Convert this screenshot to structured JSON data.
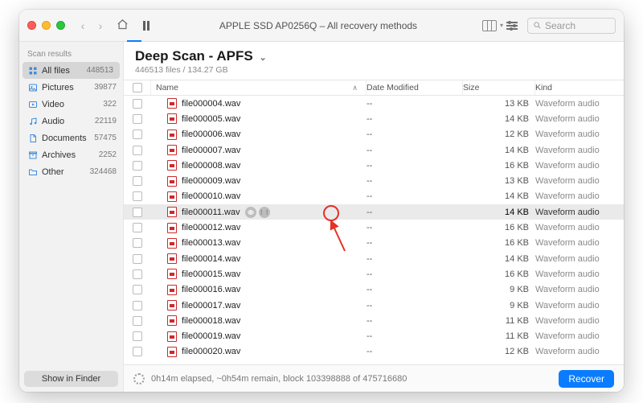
{
  "window": {
    "title": "APPLE SSD AP0256Q – All recovery methods",
    "search_placeholder": "Search"
  },
  "sidebar": {
    "heading": "Scan results",
    "show_in_finder": "Show in Finder",
    "items": [
      {
        "icon": "grid",
        "color": "#3e8de0",
        "label": "All files",
        "count": "448513",
        "active": true
      },
      {
        "icon": "image",
        "color": "#3e8de0",
        "label": "Pictures",
        "count": "39877",
        "active": false
      },
      {
        "icon": "video",
        "color": "#3e8de0",
        "label": "Video",
        "count": "322",
        "active": false
      },
      {
        "icon": "music",
        "color": "#3e8de0",
        "label": "Audio",
        "count": "22119",
        "active": false
      },
      {
        "icon": "doc",
        "color": "#3e8de0",
        "label": "Documents",
        "count": "57475",
        "active": false
      },
      {
        "icon": "archive",
        "color": "#3e8de0",
        "label": "Archives",
        "count": "2252",
        "active": false
      },
      {
        "icon": "folder",
        "color": "#3e8de0",
        "label": "Other",
        "count": "324468",
        "active": false
      }
    ]
  },
  "header": {
    "title": "Deep Scan - APFS",
    "subtitle": "446513 files / 134.27 GB"
  },
  "columns": {
    "name": "Name",
    "date": "Date Modified",
    "size": "Size",
    "kind": "Kind"
  },
  "rows": [
    {
      "name": "file000004.wav",
      "date": "--",
      "size": "13 KB",
      "kind": "Waveform audio",
      "selected": false
    },
    {
      "name": "file000005.wav",
      "date": "--",
      "size": "14 KB",
      "kind": "Waveform audio",
      "selected": false
    },
    {
      "name": "file000006.wav",
      "date": "--",
      "size": "12 KB",
      "kind": "Waveform audio",
      "selected": false
    },
    {
      "name": "file000007.wav",
      "date": "--",
      "size": "14 KB",
      "kind": "Waveform audio",
      "selected": false
    },
    {
      "name": "file000008.wav",
      "date": "--",
      "size": "16 KB",
      "kind": "Waveform audio",
      "selected": false
    },
    {
      "name": "file000009.wav",
      "date": "--",
      "size": "13 KB",
      "kind": "Waveform audio",
      "selected": false
    },
    {
      "name": "file000010.wav",
      "date": "--",
      "size": "14 KB",
      "kind": "Waveform audio",
      "selected": false
    },
    {
      "name": "file000011.wav",
      "date": "--",
      "size": "14 KB",
      "kind": "Waveform audio",
      "selected": true
    },
    {
      "name": "file000012.wav",
      "date": "--",
      "size": "16 KB",
      "kind": "Waveform audio",
      "selected": false
    },
    {
      "name": "file000013.wav",
      "date": "--",
      "size": "16 KB",
      "kind": "Waveform audio",
      "selected": false
    },
    {
      "name": "file000014.wav",
      "date": "--",
      "size": "14 KB",
      "kind": "Waveform audio",
      "selected": false
    },
    {
      "name": "file000015.wav",
      "date": "--",
      "size": "16 KB",
      "kind": "Waveform audio",
      "selected": false
    },
    {
      "name": "file000016.wav",
      "date": "--",
      "size": "9 KB",
      "kind": "Waveform audio",
      "selected": false
    },
    {
      "name": "file000017.wav",
      "date": "--",
      "size": "9 KB",
      "kind": "Waveform audio",
      "selected": false
    },
    {
      "name": "file000018.wav",
      "date": "--",
      "size": "11 KB",
      "kind": "Waveform audio",
      "selected": false
    },
    {
      "name": "file000019.wav",
      "date": "--",
      "size": "11 KB",
      "kind": "Waveform audio",
      "selected": false
    },
    {
      "name": "file000020.wav",
      "date": "--",
      "size": "12 KB",
      "kind": "Waveform audio",
      "selected": false
    }
  ],
  "footer": {
    "status": "0h14m elapsed, ~0h54m remain, block 103398888 of 475716680",
    "recover": "Recover"
  }
}
